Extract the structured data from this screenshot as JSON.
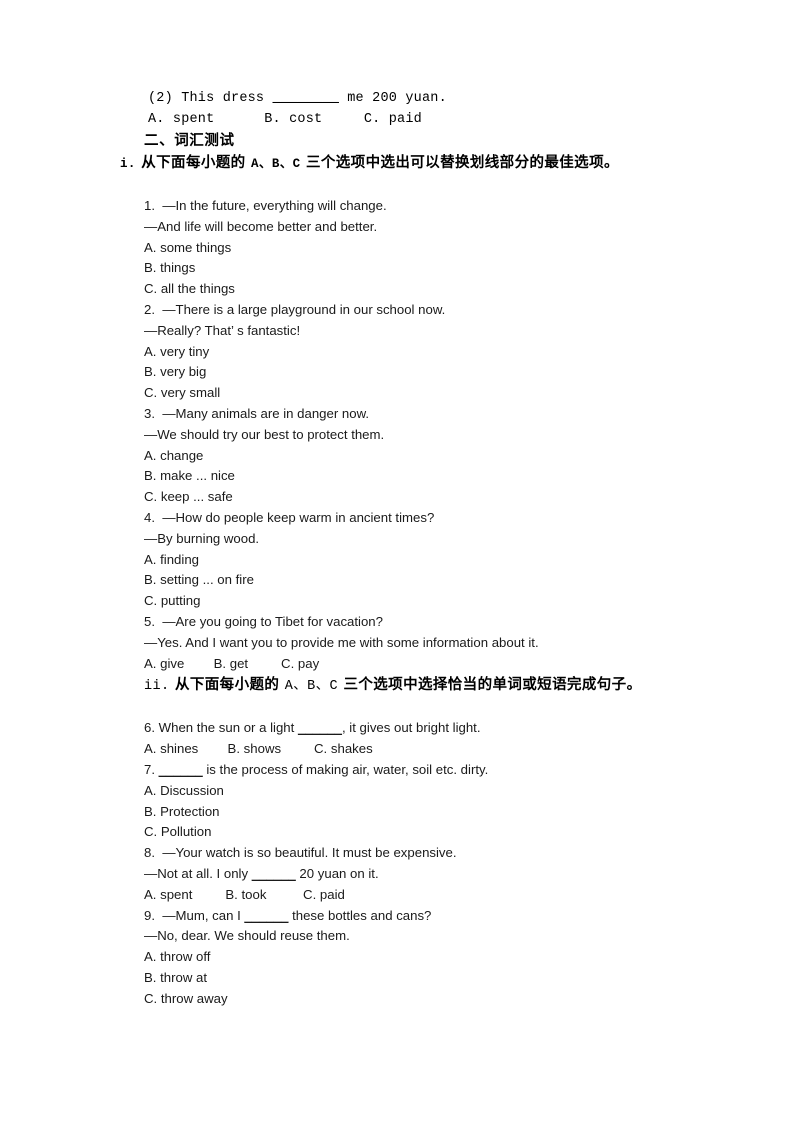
{
  "document": {
    "page_background": "#ffffff",
    "text_color": "#1a1a1a"
  },
  "carryover_exercise": {
    "stem": "(2) This dress ________ me 200 yuan.",
    "stem_prefix": "(2) This dress ",
    "stem_blank": "________",
    "stem_suffix": " me 200 yuan.",
    "options_line": "A. spent      B. cost     C. paid",
    "option_a": "A. spent",
    "option_b": "B. cost",
    "option_c": "C. paid"
  },
  "section": {
    "heading": "二、词汇测试"
  },
  "part_i": {
    "marker": "i.",
    "latin_options": "A、B、C",
    "instruction_before": " 从下面每小题的 ",
    "instruction_after": " 三个选项中选出可以替换划线部分的最佳选项。",
    "instruction_full": "i.  从下面每小题的 A、B、C 三个选项中选出可以替换划线部分的最佳选项。",
    "questions": [
      {
        "number": "1.",
        "line1": "1.  —In the future, everything will change.",
        "line2": "—And life will become better and better.",
        "options": [
          "A. some things",
          "B. things",
          "C. all the things"
        ],
        "options_inline": false
      },
      {
        "number": "2.",
        "line1": "2.  —There is a large playground in our school now.",
        "line2": "—Really? That’ s fantastic!",
        "options": [
          "A. very tiny",
          "B. very big",
          "C. very small"
        ],
        "options_inline": false
      },
      {
        "number": "3.",
        "line1": "3.  —Many animals are in danger now.",
        "line2": "—We should try our best to protect them.",
        "options": [
          "A. change",
          "B. make ... nice",
          "C. keep ... safe"
        ],
        "options_inline": false
      },
      {
        "number": "4.",
        "line1": "4.  —How do people keep warm in ancient times?",
        "line2": "—By burning wood.",
        "options": [
          "A. finding",
          "B. setting ... on fire",
          "C. putting"
        ],
        "options_inline": false
      },
      {
        "number": "5.",
        "line1": "5.  —Are you going to Tibet for vacation?",
        "line2": "—Yes. And I want you to provide me with some information about it.",
        "options": [
          "A. give",
          "B. get",
          "C. pay"
        ],
        "options_inline": true,
        "options_line": "A. give        B. get         C. pay"
      }
    ]
  },
  "part_ii": {
    "marker": "ii.",
    "latin_options": "A、B、C",
    "instruction_before": " 从下面每小题的 ",
    "instruction_after": " 三个选项中选择恰当的单词或短语完成句子。",
    "instruction_full": "ii. 从下面每小题的 A、B、C 三个选项中选择恰当的单词或短语完成句子。",
    "questions": [
      {
        "number": "6.",
        "line1_prefix": "6. When the sun or a light ",
        "line1_blank": "______",
        "line1_suffix": ", it gives out bright light.",
        "options": [
          "A. shines",
          "B. shows",
          "C. shakes"
        ],
        "options_inline": true,
        "options_line": "A. shines        B. shows         C. shakes"
      },
      {
        "number": "7.",
        "line1_prefix": "7. ",
        "line1_blank": "______",
        "line1_suffix": " is the process of making air, water, soil etc. dirty.",
        "options": [
          "A. Discussion",
          "B. Protection",
          "C. Pollution"
        ],
        "options_inline": false
      },
      {
        "number": "8.",
        "line1": "8.  —Your watch is so beautiful. It must be expensive.",
        "line2_prefix": "—Not at all. I only ",
        "line2_blank": "______",
        "line2_suffix": " 20 yuan on it.",
        "options": [
          "A. spent",
          "B. took",
          "C. paid"
        ],
        "options_inline": true,
        "options_line": "A. spent         B. took          C. paid"
      },
      {
        "number": "9.",
        "line1_prefix": "9.  —Mum, can I ",
        "line1_blank": "______",
        "line1_suffix": " these bottles and cans?",
        "line2": "—No, dear. We should reuse them.",
        "options": [
          "A. throw off",
          "B. throw at",
          "C. throw away"
        ],
        "options_inline": false
      }
    ]
  }
}
